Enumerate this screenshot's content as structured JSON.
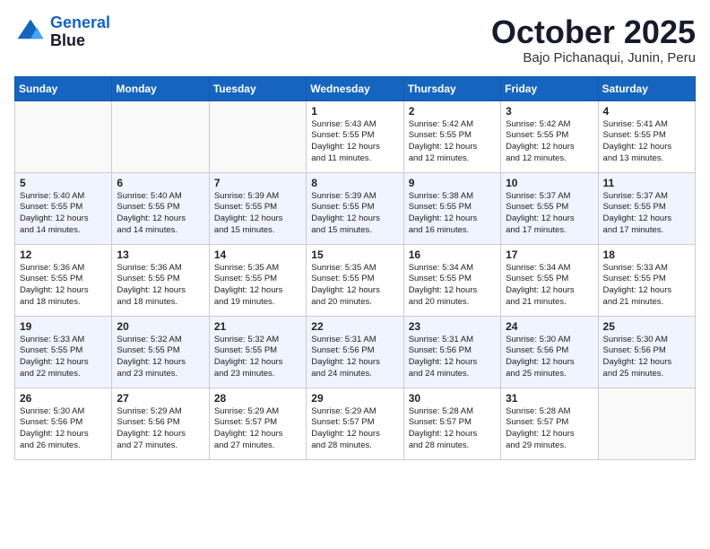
{
  "header": {
    "logo_line1": "General",
    "logo_line2": "Blue",
    "month": "October 2025",
    "location": "Bajo Pichanaqui, Junin, Peru"
  },
  "weekdays": [
    "Sunday",
    "Monday",
    "Tuesday",
    "Wednesday",
    "Thursday",
    "Friday",
    "Saturday"
  ],
  "weeks": [
    [
      {
        "day": "",
        "info": ""
      },
      {
        "day": "",
        "info": ""
      },
      {
        "day": "",
        "info": ""
      },
      {
        "day": "1",
        "info": "Sunrise: 5:43 AM\nSunset: 5:55 PM\nDaylight: 12 hours\nand 11 minutes."
      },
      {
        "day": "2",
        "info": "Sunrise: 5:42 AM\nSunset: 5:55 PM\nDaylight: 12 hours\nand 12 minutes."
      },
      {
        "day": "3",
        "info": "Sunrise: 5:42 AM\nSunset: 5:55 PM\nDaylight: 12 hours\nand 12 minutes."
      },
      {
        "day": "4",
        "info": "Sunrise: 5:41 AM\nSunset: 5:55 PM\nDaylight: 12 hours\nand 13 minutes."
      }
    ],
    [
      {
        "day": "5",
        "info": "Sunrise: 5:40 AM\nSunset: 5:55 PM\nDaylight: 12 hours\nand 14 minutes."
      },
      {
        "day": "6",
        "info": "Sunrise: 5:40 AM\nSunset: 5:55 PM\nDaylight: 12 hours\nand 14 minutes."
      },
      {
        "day": "7",
        "info": "Sunrise: 5:39 AM\nSunset: 5:55 PM\nDaylight: 12 hours\nand 15 minutes."
      },
      {
        "day": "8",
        "info": "Sunrise: 5:39 AM\nSunset: 5:55 PM\nDaylight: 12 hours\nand 15 minutes."
      },
      {
        "day": "9",
        "info": "Sunrise: 5:38 AM\nSunset: 5:55 PM\nDaylight: 12 hours\nand 16 minutes."
      },
      {
        "day": "10",
        "info": "Sunrise: 5:37 AM\nSunset: 5:55 PM\nDaylight: 12 hours\nand 17 minutes."
      },
      {
        "day": "11",
        "info": "Sunrise: 5:37 AM\nSunset: 5:55 PM\nDaylight: 12 hours\nand 17 minutes."
      }
    ],
    [
      {
        "day": "12",
        "info": "Sunrise: 5:36 AM\nSunset: 5:55 PM\nDaylight: 12 hours\nand 18 minutes."
      },
      {
        "day": "13",
        "info": "Sunrise: 5:36 AM\nSunset: 5:55 PM\nDaylight: 12 hours\nand 18 minutes."
      },
      {
        "day": "14",
        "info": "Sunrise: 5:35 AM\nSunset: 5:55 PM\nDaylight: 12 hours\nand 19 minutes."
      },
      {
        "day": "15",
        "info": "Sunrise: 5:35 AM\nSunset: 5:55 PM\nDaylight: 12 hours\nand 20 minutes."
      },
      {
        "day": "16",
        "info": "Sunrise: 5:34 AM\nSunset: 5:55 PM\nDaylight: 12 hours\nand 20 minutes."
      },
      {
        "day": "17",
        "info": "Sunrise: 5:34 AM\nSunset: 5:55 PM\nDaylight: 12 hours\nand 21 minutes."
      },
      {
        "day": "18",
        "info": "Sunrise: 5:33 AM\nSunset: 5:55 PM\nDaylight: 12 hours\nand 21 minutes."
      }
    ],
    [
      {
        "day": "19",
        "info": "Sunrise: 5:33 AM\nSunset: 5:55 PM\nDaylight: 12 hours\nand 22 minutes."
      },
      {
        "day": "20",
        "info": "Sunrise: 5:32 AM\nSunset: 5:55 PM\nDaylight: 12 hours\nand 23 minutes."
      },
      {
        "day": "21",
        "info": "Sunrise: 5:32 AM\nSunset: 5:55 PM\nDaylight: 12 hours\nand 23 minutes."
      },
      {
        "day": "22",
        "info": "Sunrise: 5:31 AM\nSunset: 5:56 PM\nDaylight: 12 hours\nand 24 minutes."
      },
      {
        "day": "23",
        "info": "Sunrise: 5:31 AM\nSunset: 5:56 PM\nDaylight: 12 hours\nand 24 minutes."
      },
      {
        "day": "24",
        "info": "Sunrise: 5:30 AM\nSunset: 5:56 PM\nDaylight: 12 hours\nand 25 minutes."
      },
      {
        "day": "25",
        "info": "Sunrise: 5:30 AM\nSunset: 5:56 PM\nDaylight: 12 hours\nand 25 minutes."
      }
    ],
    [
      {
        "day": "26",
        "info": "Sunrise: 5:30 AM\nSunset: 5:56 PM\nDaylight: 12 hours\nand 26 minutes."
      },
      {
        "day": "27",
        "info": "Sunrise: 5:29 AM\nSunset: 5:56 PM\nDaylight: 12 hours\nand 27 minutes."
      },
      {
        "day": "28",
        "info": "Sunrise: 5:29 AM\nSunset: 5:57 PM\nDaylight: 12 hours\nand 27 minutes."
      },
      {
        "day": "29",
        "info": "Sunrise: 5:29 AM\nSunset: 5:57 PM\nDaylight: 12 hours\nand 28 minutes."
      },
      {
        "day": "30",
        "info": "Sunrise: 5:28 AM\nSunset: 5:57 PM\nDaylight: 12 hours\nand 28 minutes."
      },
      {
        "day": "31",
        "info": "Sunrise: 5:28 AM\nSunset: 5:57 PM\nDaylight: 12 hours\nand 29 minutes."
      },
      {
        "day": "",
        "info": ""
      }
    ]
  ]
}
